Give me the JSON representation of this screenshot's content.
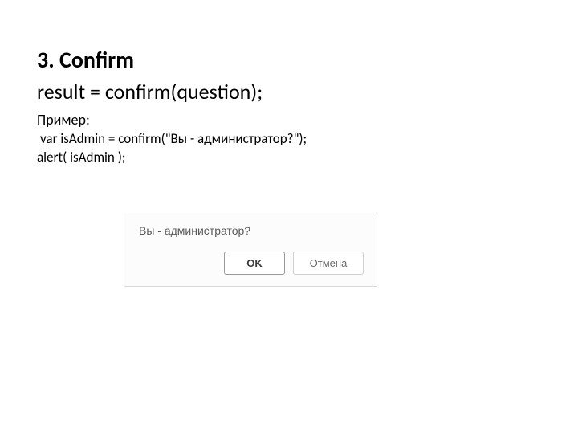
{
  "heading": "3. Confirm",
  "syntax": "result = confirm(question);",
  "example_label": "Пример:",
  "code_line_1": " var isAdmin = confirm(\"Вы - администратор?\");",
  "code_line_2": "alert( isAdmin );",
  "dialog": {
    "message": "Вы - администратор?",
    "ok_label": "OK",
    "cancel_label": "Отмена"
  }
}
